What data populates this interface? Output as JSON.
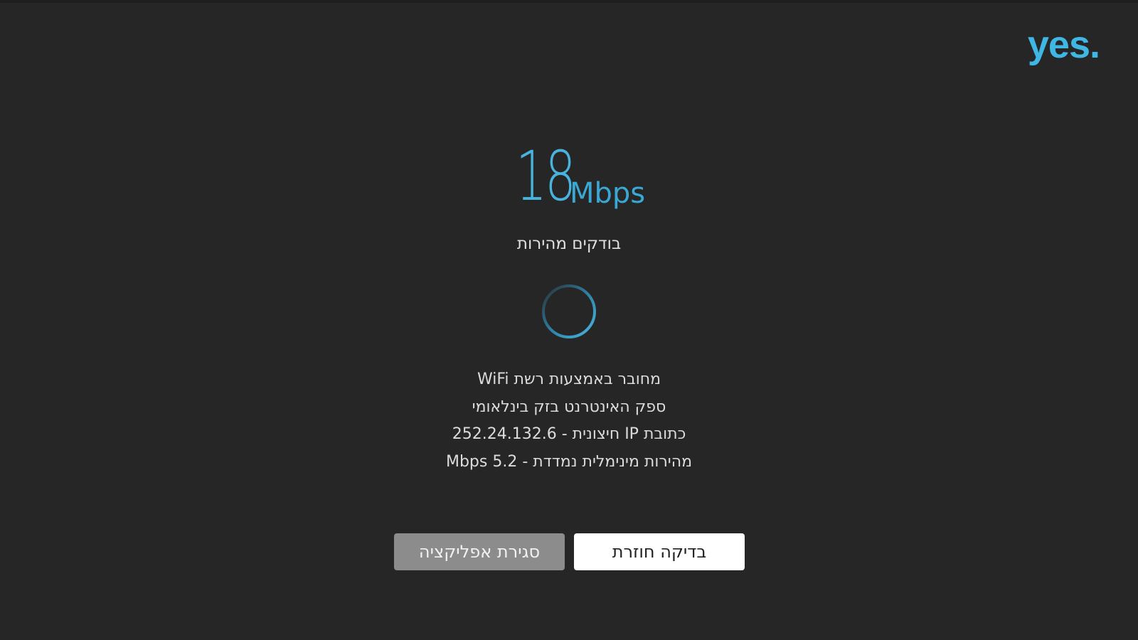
{
  "brand": {
    "logo_text": "yes.",
    "accent_color": "#3fb6e3"
  },
  "speed": {
    "value": "18",
    "unit": "Mbps"
  },
  "status_text": "בודקים מהירות",
  "spinner": {
    "icon": "loading-spinner-icon",
    "color": "#3aa8d4"
  },
  "info_lines": [
    "מחובר באמצעות רשת WiFi",
    "ספק האינטרנט בזק בינלאומי",
    "כתובת IP חיצונית - 252.24.132.6",
    "מהירות מינימלית נמדדת - Mbps 5.2"
  ],
  "buttons": {
    "close_label": "סגירת אפליקציה",
    "retry_label": "בדיקה חוזרת"
  }
}
